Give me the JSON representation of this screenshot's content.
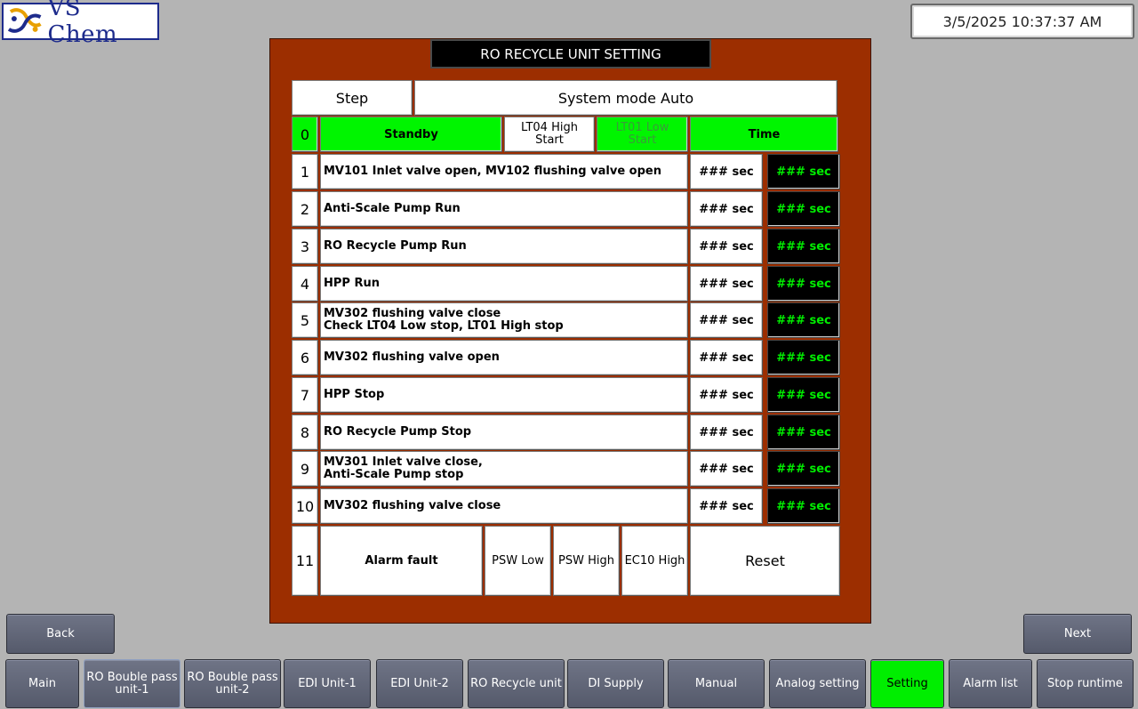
{
  "header": {
    "logo_text": "VS Chem",
    "datetime": "3/5/2025 10:37:37 AM"
  },
  "screen_title": "RO RECYCLE UNIT SETTING",
  "table": {
    "step_label": "Step",
    "mode_label": "System mode Auto",
    "row0": {
      "num": "0",
      "standby": "Standby",
      "lt04": "LT04 High\nStart",
      "lt01": "LT01 Low\nStart",
      "time": "Time"
    },
    "rows": [
      {
        "num": "1",
        "desc": "MV101 Inlet valve open, MV102 flushing valve open",
        "set": "### sec",
        "actual": "### sec"
      },
      {
        "num": "2",
        "desc": "Anti-Scale Pump Run",
        "set": "### sec",
        "actual": "### sec"
      },
      {
        "num": "3",
        "desc": "RO Recycle Pump Run",
        "set": "### sec",
        "actual": "### sec"
      },
      {
        "num": "4",
        "desc": "HPP Run",
        "set": "### sec",
        "actual": "### sec"
      },
      {
        "num": "5",
        "desc": "MV302 flushing valve close\nCheck LT04 Low stop, LT01 High stop",
        "set": "### sec",
        "actual": "### sec"
      },
      {
        "num": "6",
        "desc": "MV302 flushing valve open",
        "set": "### sec",
        "actual": "### sec"
      },
      {
        "num": "7",
        "desc": "HPP Stop",
        "set": "### sec",
        "actual": "### sec"
      },
      {
        "num": "8",
        "desc": "RO Recycle Pump Stop",
        "set": "### sec",
        "actual": "### sec"
      },
      {
        "num": "9",
        "desc": "MV301 Inlet valve close,\nAnti-Scale Pump stop",
        "set": "### sec",
        "actual": "### sec"
      },
      {
        "num": "10",
        "desc": "MV302 flushing valve close",
        "set": "### sec",
        "actual": "### sec"
      }
    ],
    "row11": {
      "num": "11",
      "alarm": "Alarm fault",
      "psw_low": "PSW Low",
      "psw_high": "PSW High",
      "ec10_high": "EC10 High",
      "reset": "Reset"
    }
  },
  "nav": {
    "back": "Back",
    "next": "Next",
    "items": [
      "Main",
      "RO Bouble pass\nunit-1",
      "RO Bouble pass\nunit-2",
      "EDI Unit-1",
      "EDI Unit-2",
      "RO Recycle unit",
      "DI Supply",
      "Manual",
      "Analog setting",
      "Setting",
      "Alarm list",
      "Stop runtime"
    ]
  },
  "colors": {
    "panel": "#9c2e00",
    "active_green": "#00ee00",
    "button": "#5e6374"
  }
}
